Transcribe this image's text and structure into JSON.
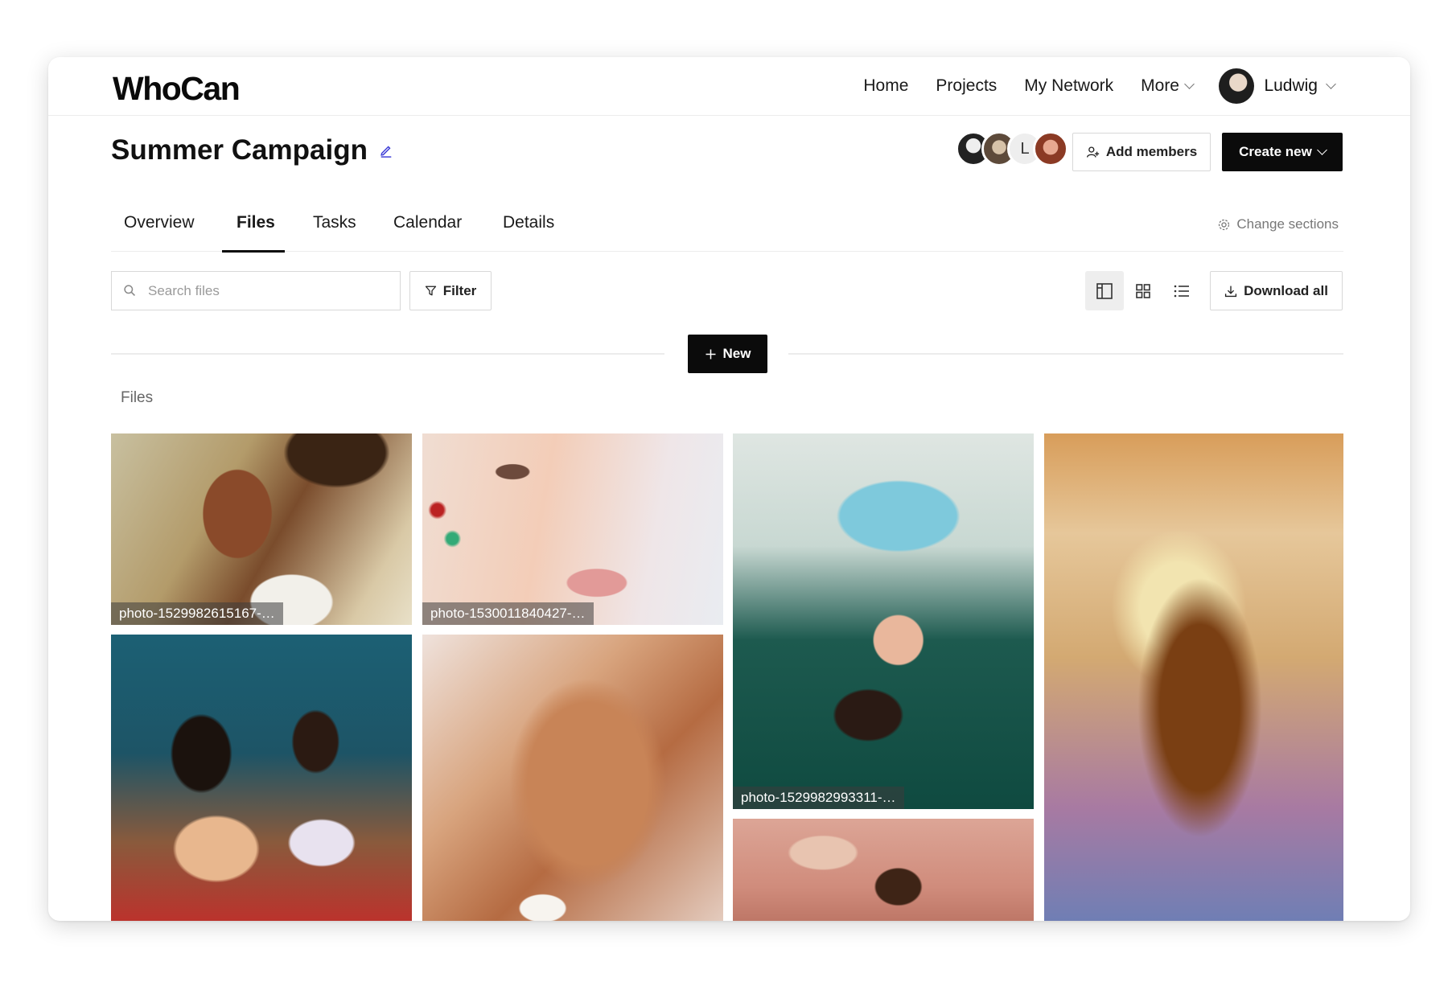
{
  "header": {
    "logo": "WhoCan",
    "nav": [
      "Home",
      "Projects",
      "My Network",
      "More"
    ],
    "user": {
      "name": "Ludwig"
    }
  },
  "project": {
    "title": "Summer Campaign",
    "member_initial": "L",
    "add_members_label": "Add members",
    "create_new_label": "Create new"
  },
  "tabs": {
    "items": [
      "Overview",
      "Files",
      "Tasks",
      "Calendar",
      "Details"
    ],
    "active": "Files",
    "change_sections_label": "Change sections"
  },
  "toolbar": {
    "search_placeholder": "Search files",
    "filter_label": "Filter",
    "download_label": "Download all",
    "new_label": "New",
    "active_view": "gallery"
  },
  "files": {
    "section_label": "Files",
    "captions": {
      "p1": "photo-1529982615167-…",
      "p2": "photo-1530011840427-…",
      "p3": "photo-1529982993311-…"
    }
  },
  "colors": {
    "primary": "#0b0b0b",
    "border": "#d8d8d8",
    "muted": "#777777"
  }
}
